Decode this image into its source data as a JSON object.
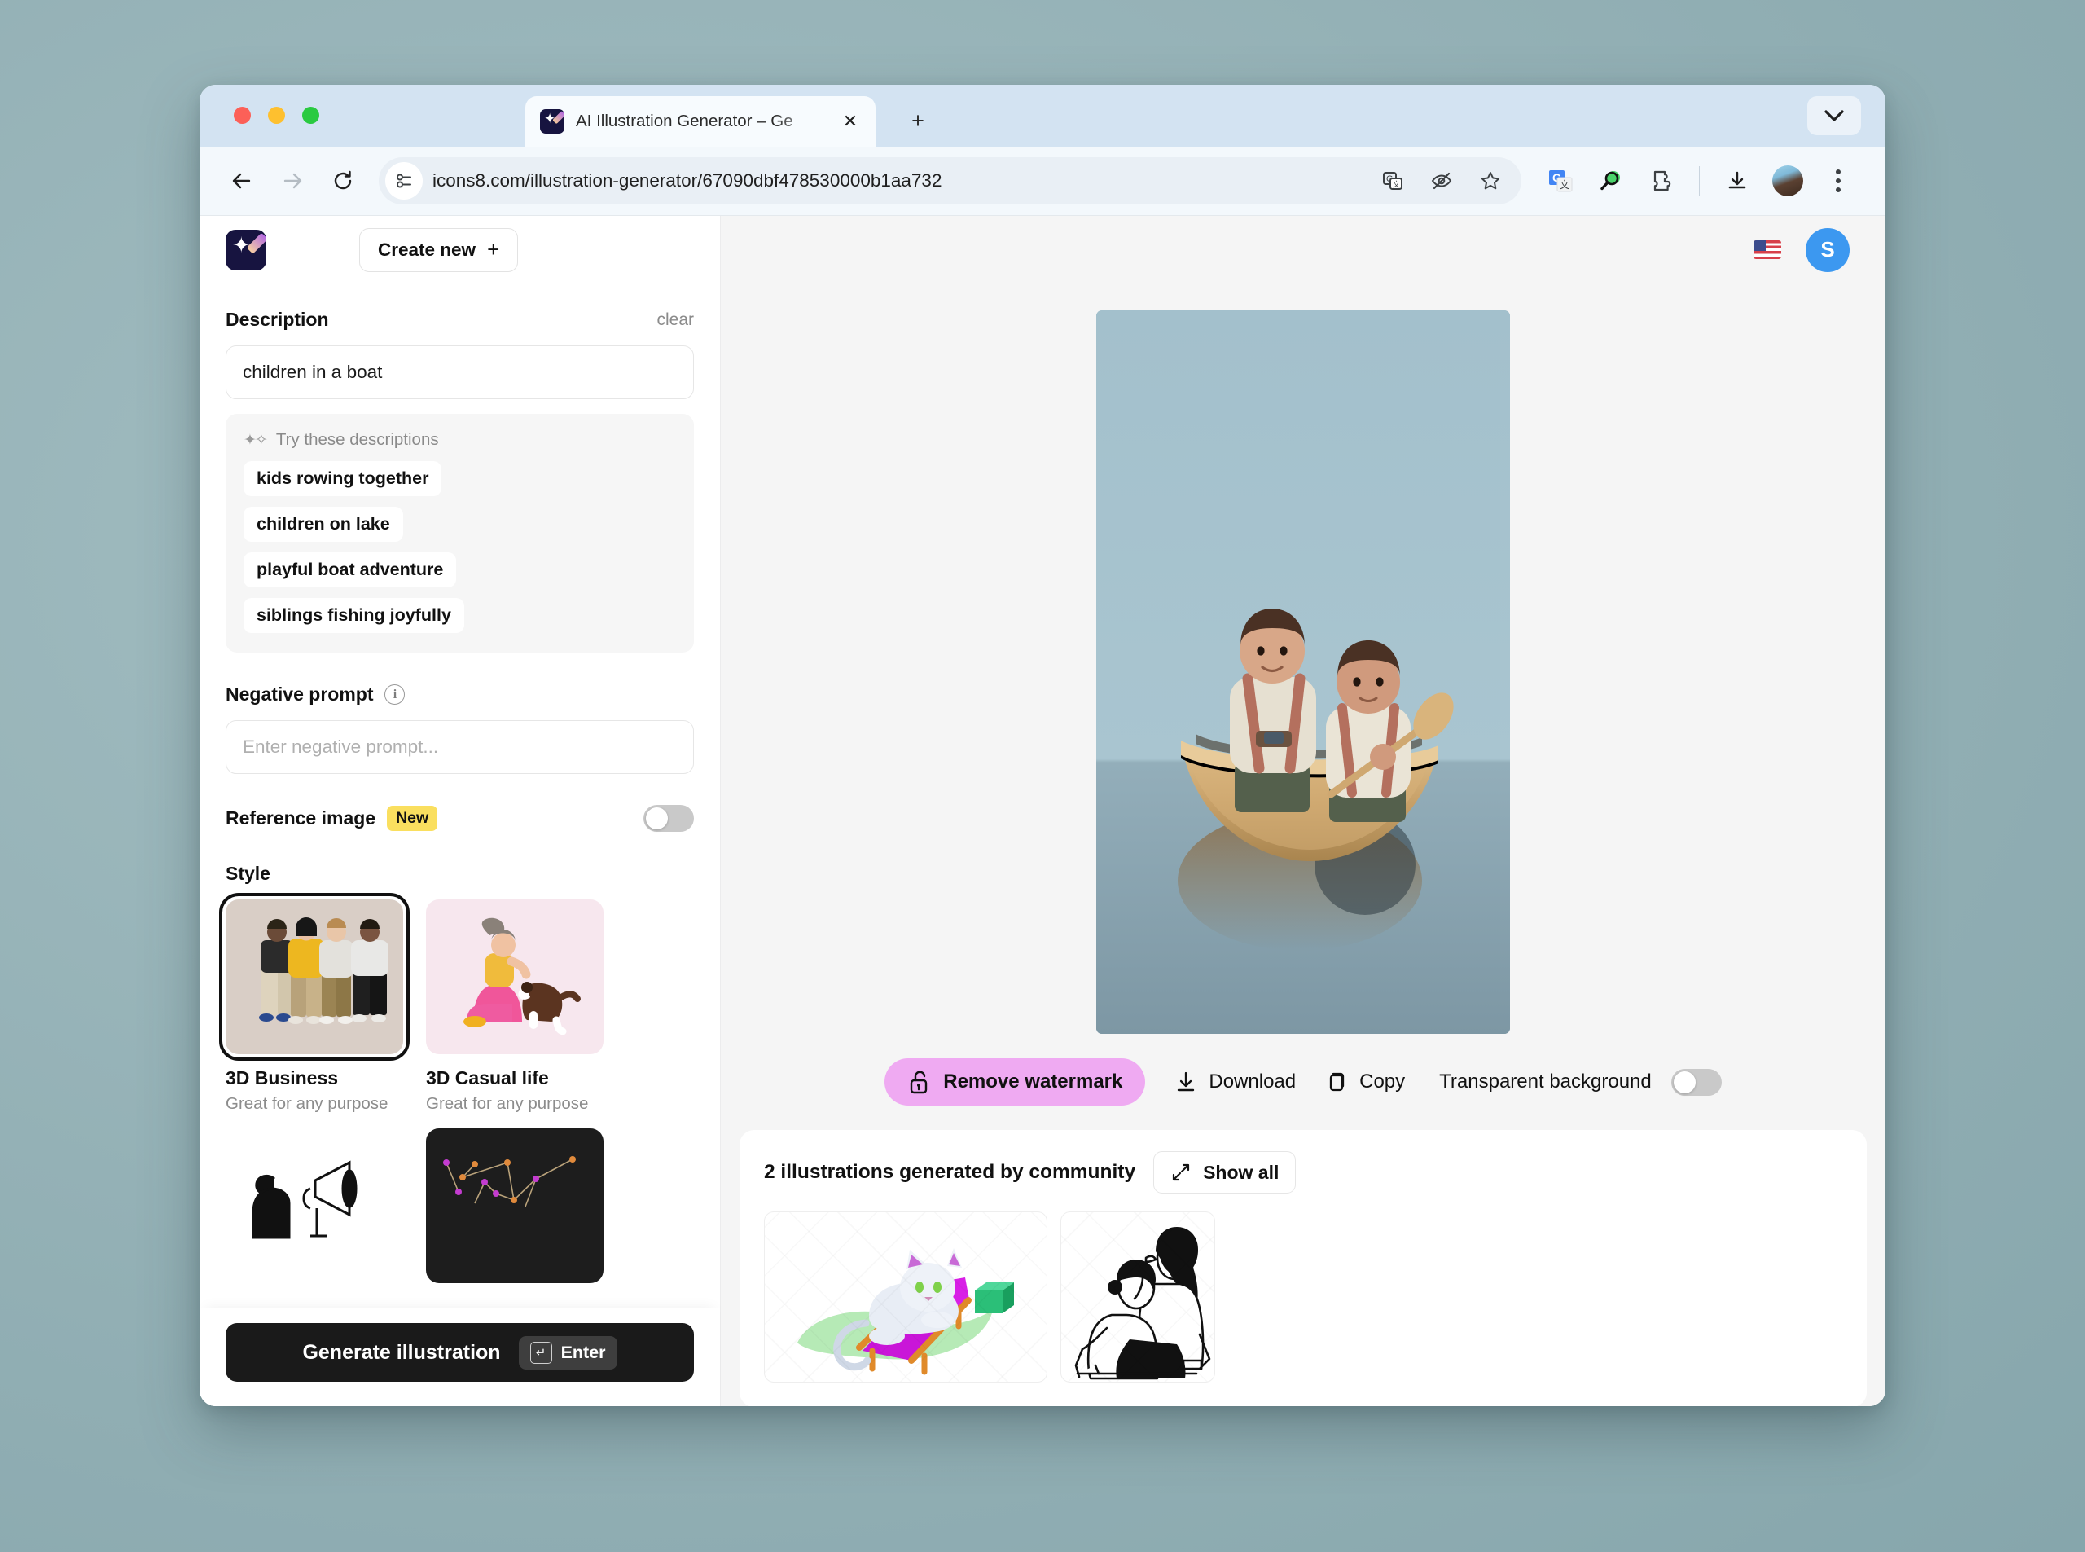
{
  "browser": {
    "tab_title": "AI Illustration Generator – Ge",
    "url": "icons8.com/illustration-generator/67090dbf478530000b1aa732",
    "new_tab_label": "+",
    "close_label": "✕",
    "icons": {
      "back": "back-arrow-icon",
      "forward": "forward-arrow-icon",
      "reload": "reload-icon",
      "site_info": "site-settings-icon",
      "translate": "translate-icon",
      "hide": "eye-off-icon",
      "bookmark": "star-icon",
      "google_translate": "google-translate-extension-icon",
      "search_ext": "magnifier-extension-icon",
      "extensions": "puzzle-piece-icon",
      "downloads": "download-icon",
      "profile": "profile-avatar-icon",
      "menu": "kebab-menu-icon",
      "tab_list": "chevron-down-icon"
    }
  },
  "sidebar": {
    "create_new_label": "Create new",
    "create_new_plus": "+",
    "description": {
      "title": "Description",
      "clear_label": "clear",
      "value": "children in a boat"
    },
    "suggestions": {
      "heading": "Try these descriptions",
      "chips": [
        "kids rowing together",
        "children on lake",
        "playful boat adventure",
        "siblings fishing joyfully"
      ]
    },
    "negative_prompt": {
      "title": "Negative prompt",
      "placeholder": "Enter negative prompt...",
      "value": ""
    },
    "reference_image": {
      "title": "Reference image",
      "badge": "New",
      "enabled": false
    },
    "style": {
      "title": "Style",
      "cards": [
        {
          "name": "3D Business",
          "subtitle": "Great for any purpose",
          "selected": true
        },
        {
          "name": "3D Casual life",
          "subtitle": "Great for any purpose",
          "selected": false
        }
      ]
    },
    "generate": {
      "label": "Generate illustration",
      "shortcut": "Enter",
      "key_glyph": "↵"
    }
  },
  "header": {
    "language_flag": "us-flag-icon",
    "avatar_initial": "S"
  },
  "preview": {
    "alt": "3D illustration of two children rowing a wooden boat on calm water"
  },
  "actions": {
    "remove_watermark": "Remove watermark",
    "download": "Download",
    "copy": "Copy",
    "transparent_background": "Transparent background",
    "transparent_enabled": false
  },
  "community": {
    "title": "2 illustrations generated by community",
    "show_all": "Show all",
    "count": 2,
    "items": [
      {
        "alt": "white cat lounging on a magenta deck chair"
      },
      {
        "alt": "line-art of two women sitting together"
      }
    ]
  },
  "colors": {
    "accent_pink": "#efaaf2",
    "badge_yellow": "#fadf5f",
    "avatar_blue": "#3c98f0",
    "dark_button": "#1a1a1a",
    "desktop": "#93b0b5"
  }
}
